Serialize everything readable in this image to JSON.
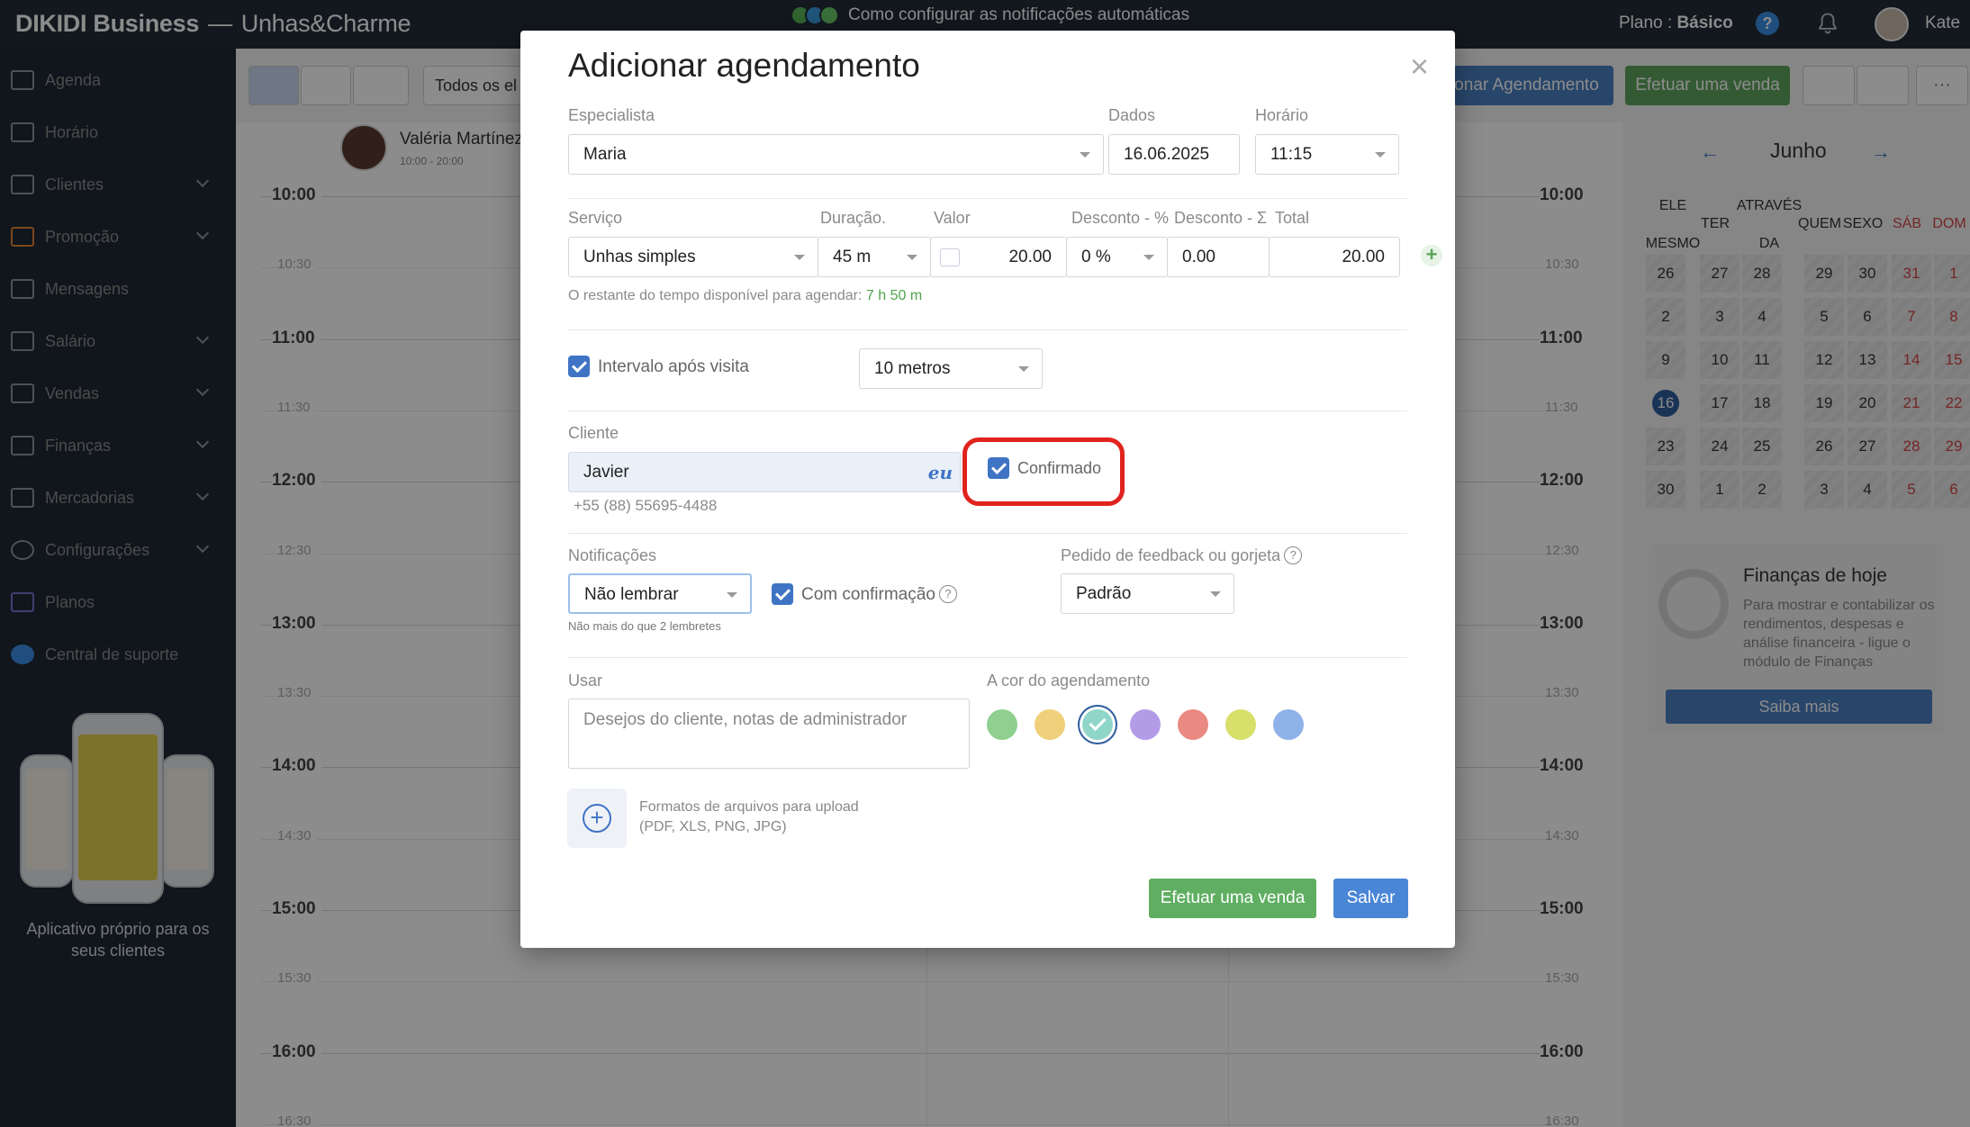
{
  "topbar": {
    "brand": "DIKIDI Business",
    "separator": "—",
    "salon": "Unhas&Charme",
    "notice": "Como configurar as notificações automáticas",
    "plan_label": "Plano :",
    "plan_value": "Básico",
    "help": "?",
    "user": "Kate"
  },
  "sidebar": {
    "items": [
      {
        "label": "Agenda"
      },
      {
        "label": "Horário"
      },
      {
        "label": "Clientes"
      },
      {
        "label": "Promoção"
      },
      {
        "label": "Mensagens"
      },
      {
        "label": "Salário"
      },
      {
        "label": "Vendas"
      },
      {
        "label": "Finanças"
      },
      {
        "label": "Mercadorias"
      },
      {
        "label": "Configurações"
      },
      {
        "label": "Planos"
      },
      {
        "label": "Central de suporte"
      }
    ],
    "promo": "Aplicativo próprio para os seus clientes"
  },
  "toolbar": {
    "filter": "Todos os el",
    "add_appointment": "Adicionar Agendamento",
    "make_sale": "Efetuar uma venda",
    "more": "···"
  },
  "specialist": {
    "name": "Valéria Martínez",
    "hours": "10:00 - 20:00"
  },
  "times": [
    "10:00",
    "10:30",
    "11:00",
    "11:30",
    "12:00",
    "12:30",
    "13:00",
    "13:30",
    "14:00",
    "14:30",
    "15:00",
    "15:30",
    "16:00",
    "16:30"
  ],
  "mini_calendar": {
    "month": "Junho",
    "prev": "←",
    "next": "→",
    "dow": [
      "ELE MESMO",
      "TER",
      "ATRAVÉS DA",
      "QUEM",
      "SEXO",
      "SÁB",
      "DOM"
    ],
    "weeks": [
      [
        "26",
        "27",
        "28",
        "29",
        "30",
        "31",
        "1"
      ],
      [
        "2",
        "3",
        "4",
        "5",
        "6",
        "7",
        "8"
      ],
      [
        "9",
        "10",
        "11",
        "12",
        "13",
        "14",
        "15"
      ],
      [
        "16",
        "17",
        "18",
        "19",
        "20",
        "21",
        "22"
      ],
      [
        "23",
        "24",
        "25",
        "26",
        "27",
        "28",
        "29"
      ],
      [
        "30",
        "1",
        "2",
        "3",
        "4",
        "5",
        "6"
      ]
    ],
    "today": "16"
  },
  "finance_card": {
    "title": "Finanças de hoje",
    "text": "Para mostrar e contabilizar os rendimentos, despesas e análise financeira - ligue o módulo de Finanças",
    "button": "Saiba mais"
  },
  "modal": {
    "title": "Adicionar agendamento",
    "close": "×",
    "specialist_label": "Especialista",
    "specialist_value": "Maria",
    "date_label": "Dados",
    "date_value": "16.06.2025",
    "time_label": "Horário",
    "time_value": "11:15",
    "service_label": "Serviço",
    "service_value": "Unhas simples",
    "duration_label": "Duração.",
    "duration_value": "45 m",
    "price_label": "Valor",
    "price_value": "20.00",
    "discount_pct_label": "Desconto - %",
    "discount_pct_value": "0 %",
    "discount_sum_label": "Desconto - Σ",
    "discount_sum_value": "0.00",
    "total_label": "Total",
    "total_value": "20.00",
    "remaining_text": "O restante do tempo disponível para agendar:",
    "remaining_value": "7 h 50 m",
    "interval_label": "Intervalo após visita",
    "interval_value": "10 metros",
    "client_label": "Cliente",
    "client_value": "Javier",
    "client_badge": "eu",
    "client_phone": "+55 (88) 55695-4488",
    "confirmed_label": "Confirmado",
    "notifications_label": "Notificações",
    "notifications_value": "Não lembrar",
    "notifications_hint": "Não mais do que 2 lembretes",
    "with_confirmation_label": "Com confirmação",
    "feedback_label": "Pedido de feedback ou gorjeta",
    "feedback_value": "Padrão",
    "notes_label": "Usar",
    "notes_placeholder": "Desejos do cliente, notas de administrador",
    "color_label": "A cor do agendamento",
    "colors": [
      "#8fcf8f",
      "#f0cf7a",
      "#8fd6c8",
      "#b49be8",
      "#ea8a82",
      "#d8df6a",
      "#8fb1ea"
    ],
    "upload_text_1": "Formatos de arquivos para upload",
    "upload_text_2": "(PDF, XLS, PNG, JPG)",
    "sale_button": "Efetuar uma venda",
    "save_button": "Salvar"
  }
}
